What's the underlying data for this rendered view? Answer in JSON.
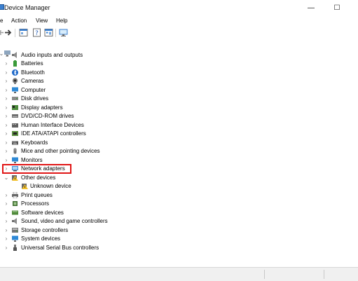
{
  "window": {
    "title": "Device Manager"
  },
  "title_buttons": {
    "minimize": "—",
    "maximize": "☐",
    "close": "✕"
  },
  "menu": [
    "e",
    "Action",
    "View",
    "Help"
  ],
  "tree": {
    "root_items": [
      {
        "label": "",
        "icon": "computer-icon",
        "expanded": false
      },
      {
        "label": "Audio inputs and outputs",
        "icon": "speaker-icon",
        "expanded": false
      },
      {
        "label": "Batteries",
        "icon": "battery-icon",
        "expanded": false
      },
      {
        "label": "Bluetooth",
        "icon": "bluetooth-icon",
        "expanded": false
      },
      {
        "label": "Cameras",
        "icon": "camera-icon",
        "expanded": false
      },
      {
        "label": "Computer",
        "icon": "monitor-icon",
        "expanded": false
      },
      {
        "label": "Disk drives",
        "icon": "disk-icon",
        "expanded": false
      },
      {
        "label": "Display adapters",
        "icon": "display-adapter-icon",
        "expanded": false
      },
      {
        "label": "DVD/CD-ROM drives",
        "icon": "dvd-icon",
        "expanded": false
      },
      {
        "label": "Human Interface Devices",
        "icon": "hid-icon",
        "expanded": false
      },
      {
        "label": "IDE ATA/ATAPI controllers",
        "icon": "ide-controller-icon",
        "expanded": false
      },
      {
        "label": "Keyboards",
        "icon": "keyboard-icon",
        "expanded": false
      },
      {
        "label": "Mice and other pointing devices",
        "icon": "mouse-icon",
        "expanded": false
      },
      {
        "label": "Monitors",
        "icon": "monitor-icon",
        "expanded": false
      },
      {
        "label": "Network adapters",
        "icon": "network-adapter-icon",
        "expanded": false,
        "highlighted": true
      },
      {
        "label": "Other devices",
        "icon": "warning-device-icon",
        "expanded": true
      },
      {
        "label": "Unknown device",
        "icon": "unknown-device-icon",
        "child": true
      },
      {
        "label": "Print queues",
        "icon": "printer-icon",
        "expanded": false
      },
      {
        "label": "Processors",
        "icon": "processor-icon",
        "expanded": false
      },
      {
        "label": "Software devices",
        "icon": "software-device-icon",
        "expanded": false
      },
      {
        "label": "Sound, video and game controllers",
        "icon": "sound-controller-icon",
        "expanded": false
      },
      {
        "label": "Storage controllers",
        "icon": "storage-controller-icon",
        "expanded": false
      },
      {
        "label": "System devices",
        "icon": "system-device-icon",
        "expanded": false
      },
      {
        "label": "Universal Serial Bus controllers",
        "icon": "usb-icon",
        "expanded": false
      }
    ]
  },
  "colors": {
    "highlight_border": "#e01515",
    "accent": "#3b7fcf"
  }
}
